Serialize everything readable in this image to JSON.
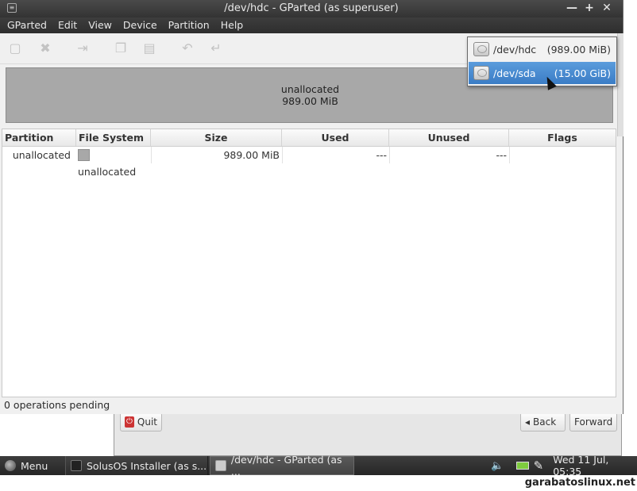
{
  "window": {
    "title": "/dev/hdc - GParted (as superuser)"
  },
  "menu": [
    "GParted",
    "Edit",
    "View",
    "Device",
    "Partition",
    "Help"
  ],
  "disk_map": {
    "label": "unallocated",
    "size": "989.00 MiB"
  },
  "table": {
    "columns": [
      "Partition",
      "File System",
      "Size",
      "Used",
      "Unused",
      "Flags"
    ],
    "rows": [
      {
        "partition": "unallocated",
        "filesystem": "unallocated",
        "size": "989.00 MiB",
        "used": "---",
        "unused": "---",
        "flags": ""
      }
    ]
  },
  "status": "0 operations pending",
  "device_menu": [
    {
      "name": "/dev/hdc",
      "size": "(989.00 MiB)",
      "selected": false
    },
    {
      "name": "/dev/sda",
      "size": "(15.00 GiB)",
      "selected": true
    }
  ],
  "installer": {
    "quit": "Quit",
    "back": "Back",
    "forward": "Forward"
  },
  "taskbar": {
    "menu": "Menu",
    "tasks": [
      "SolusOS Installer (as s...",
      "/dev/hdc - GParted (as ..."
    ],
    "clock": "Wed 11 Jul, 05:35"
  },
  "watermark": "garabatoslinux.net",
  "colors": {
    "selection": "#3a7cc5",
    "unallocated": "#a8a8a8",
    "title_bar": "#333333"
  }
}
